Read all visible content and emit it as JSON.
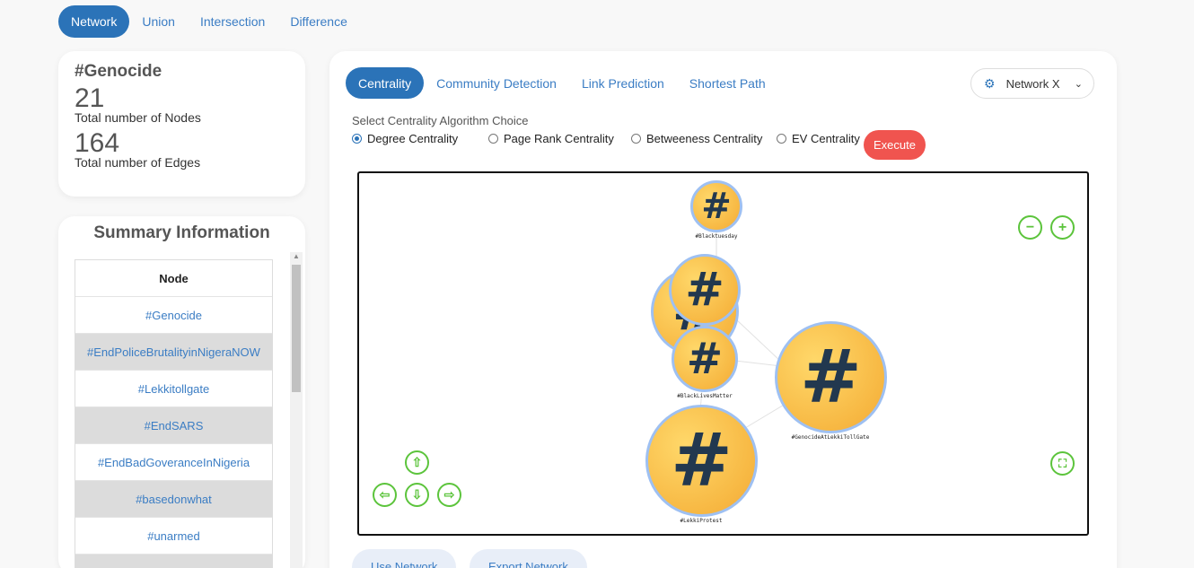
{
  "top_tabs": [
    "Network",
    "Union",
    "Intersection",
    "Difference"
  ],
  "stats": {
    "title": "#Genocide",
    "nodes_value": "21",
    "nodes_label": "Total number of Nodes",
    "edges_value": "164",
    "edges_label": "Total number of Edges"
  },
  "summary": {
    "title": "Summary Information",
    "column_header": "Node",
    "rows": [
      "#Genocide",
      "#EndPoliceBrutalityinNigeraNOW",
      "#Lekkitollgate",
      "#EndSARS",
      "#EndBadGoveranceInNigeria",
      "#basedonwhat",
      "#unarmed"
    ]
  },
  "algorithm_tabs": [
    "Centrality",
    "Community Detection",
    "Link Prediction",
    "Shortest Path"
  ],
  "library_select": {
    "value": "Network X"
  },
  "choice_label": "Select Centrality Algorithm Choice",
  "radio_options": [
    "Degree Centrality",
    "Page Rank Centrality",
    "Betweeness Centrality",
    "EV Centrality"
  ],
  "selected_radio": "Degree Centrality",
  "execute_label": "Execute",
  "graph": {
    "node_symbol": "#",
    "labels": [
      "#Blacktuesday",
      "#BlackLivesMatter",
      "#GenocideAtLekkiTollGate",
      "#LekkiProtest"
    ]
  },
  "bottom_buttons": [
    "Use Network",
    "Export Network"
  ],
  "colors": {
    "primary": "#2b73b8",
    "execute": "#f0544f",
    "controls": "#5cc43c",
    "node_border": "#9ec0f2"
  }
}
